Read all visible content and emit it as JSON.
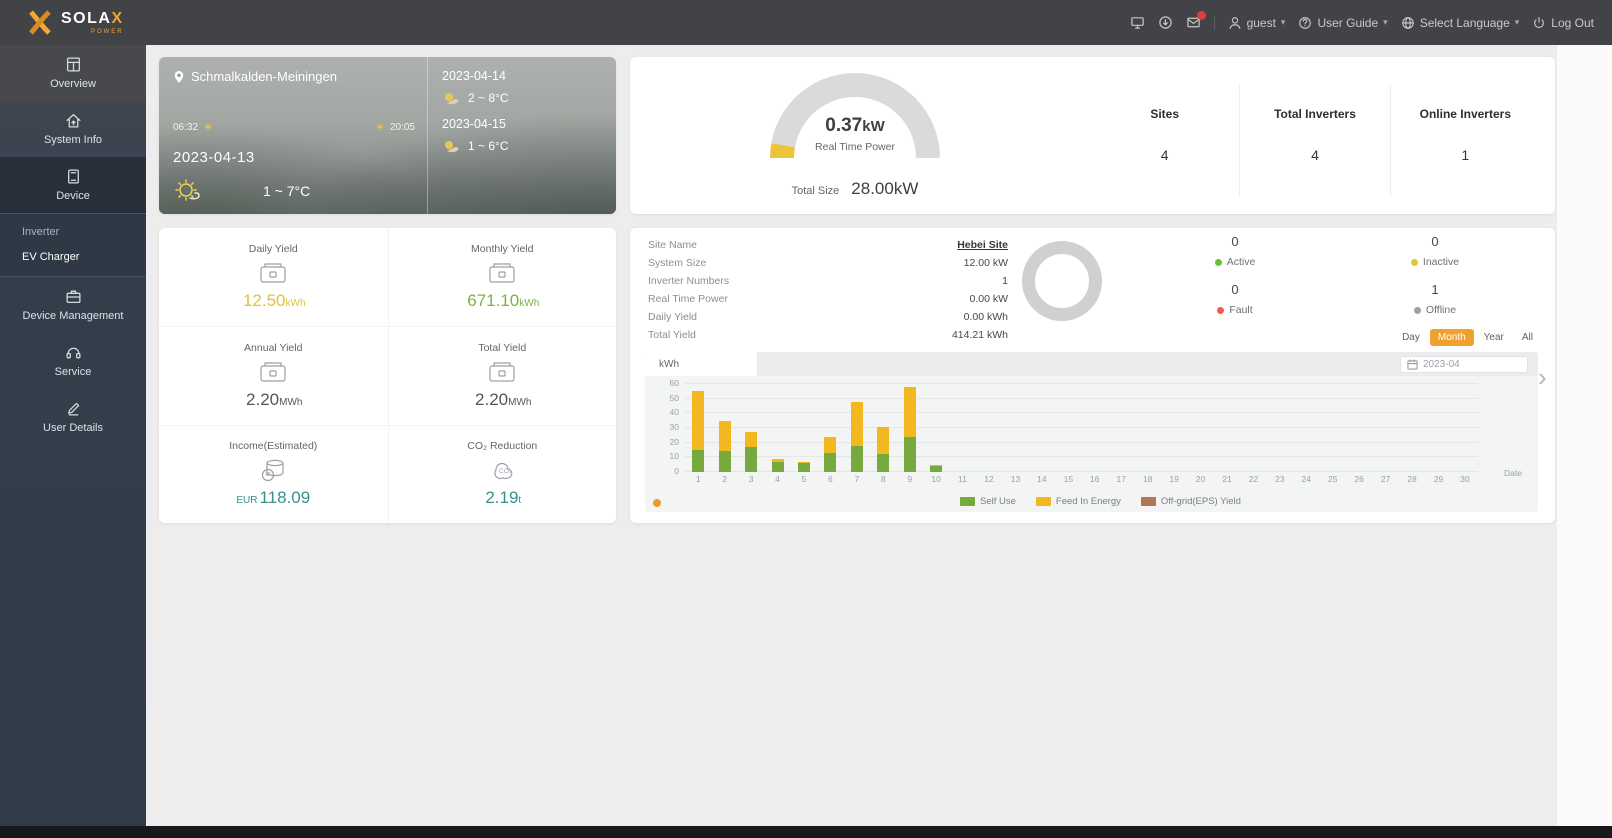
{
  "navbar": {
    "brand": "SOLA",
    "brand_x": "X",
    "brand_sub": "POWER",
    "username": "guest",
    "user_guide": "User Guide",
    "select_language": "Select Language",
    "logout": "Log Out"
  },
  "sidebar": {
    "items": [
      {
        "label": "Overview"
      },
      {
        "label": "System Info"
      },
      {
        "label": "Device"
      },
      {
        "label": "Device Management"
      },
      {
        "label": "Service"
      },
      {
        "label": "User Details"
      }
    ],
    "device_submenu": [
      {
        "label": "Inverter"
      },
      {
        "label": "EV Charger",
        "active": true
      }
    ]
  },
  "weather": {
    "location": "Schmalkalden-Meiningen",
    "sunrise": "06:32",
    "sunset": "20:05",
    "today_date": "2023-04-13",
    "today_temp": "1 ~ 7°C",
    "forecast": [
      {
        "date": "2023-04-14",
        "temp": "2 ~ 8°C"
      },
      {
        "date": "2023-04-15",
        "temp": "1 ~ 6°C"
      }
    ]
  },
  "gauge": {
    "power_value": "0.37",
    "power_unit": "kW",
    "power_label": "Real Time Power",
    "total_label": "Total Size",
    "total_value": "28.00kW",
    "stats": [
      {
        "label": "Sites",
        "value": "4"
      },
      {
        "label": "Total Inverters",
        "value": "4"
      },
      {
        "label": "Online Inverters",
        "value": "1"
      }
    ]
  },
  "yield_card": {
    "cells": [
      {
        "label": "Daily Yield",
        "prefix": "",
        "value": "12.50",
        "unit": "kWh",
        "color": "#dfc33c"
      },
      {
        "label": "Monthly Yield",
        "prefix": "",
        "value": "671.10",
        "unit": "kWh",
        "color": "#7cb342"
      },
      {
        "label": "Annual Yield",
        "prefix": "",
        "value": "2.20",
        "unit": "MWh",
        "color": "#53575c"
      },
      {
        "label": "Total Yield",
        "prefix": "",
        "value": "2.20",
        "unit": "MWh",
        "color": "#53575c"
      },
      {
        "label": "Income(Estimated)",
        "prefix": "EUR",
        "value": "118.09",
        "unit": "",
        "color": "#35918a"
      },
      {
        "label": "CO₂ Reduction",
        "prefix": "",
        "value": "2.19",
        "unit": "t",
        "color": "#35918a"
      }
    ]
  },
  "site_panel": {
    "fields": [
      {
        "label": "Site Name",
        "value": "Hebei Site"
      },
      {
        "label": "System Size",
        "value": "12.00 kW"
      },
      {
        "label": "Inverter Numbers",
        "value": "1"
      },
      {
        "label": "Real Time Power",
        "value": "0.00 kW"
      },
      {
        "label": "Daily Yield",
        "value": "0.00 kWh"
      },
      {
        "label": "Total Yield",
        "value": "414.21 kWh"
      }
    ],
    "statuses": [
      {
        "label": "Active",
        "value": "0",
        "color": "#67c23a"
      },
      {
        "label": "Inactive",
        "value": "0",
        "color": "#e6c23a"
      },
      {
        "label": "Fault",
        "value": "0",
        "color": "#f05b50"
      },
      {
        "label": "Offline",
        "value": "1",
        "color": "#9aa0a6"
      }
    ],
    "range_buttons": [
      {
        "label": "Day"
      },
      {
        "label": "Month",
        "active": true
      },
      {
        "label": "Year"
      },
      {
        "label": "All"
      }
    ],
    "date_value": "2023-04",
    "unit_tab": "kWh"
  },
  "chart_data": {
    "type": "bar",
    "stacked": true,
    "x": [
      "1",
      "2",
      "3",
      "4",
      "5",
      "6",
      "7",
      "8",
      "9",
      "10",
      "11",
      "12",
      "13",
      "14",
      "15",
      "16",
      "17",
      "18",
      "19",
      "20",
      "21",
      "22",
      "23",
      "24",
      "25",
      "26",
      "27",
      "28",
      "29",
      "30"
    ],
    "xlabel": "Date",
    "ylabel": "kWh",
    "ylim": [
      0,
      60
    ],
    "yticks": [
      0,
      10,
      20,
      30,
      40,
      50,
      60
    ],
    "grid": true,
    "legend_position": "bottom",
    "series": [
      {
        "name": "Self Use",
        "color": "#76a93e",
        "values": [
          15,
          14,
          17,
          7,
          6,
          13,
          18,
          12,
          24,
          4,
          0,
          0,
          0,
          0,
          0,
          0,
          0,
          0,
          0,
          0,
          0,
          0,
          0,
          0,
          0,
          0,
          0,
          0,
          0,
          0
        ]
      },
      {
        "name": "Feed In Energy",
        "color": "#f3b820",
        "values": [
          40,
          21,
          10,
          2,
          1,
          11,
          30,
          19,
          34,
          1,
          0,
          0,
          0,
          0,
          0,
          0,
          0,
          0,
          0,
          0,
          0,
          0,
          0,
          0,
          0,
          0,
          0,
          0,
          0,
          0
        ]
      },
      {
        "name": "Off-grid(EPS) Yield",
        "color": "#b2755a",
        "values": [
          0,
          0,
          0,
          0,
          0,
          0,
          0,
          0,
          0,
          0,
          0,
          0,
          0,
          0,
          0,
          0,
          0,
          0,
          0,
          0,
          0,
          0,
          0,
          0,
          0,
          0,
          0,
          0,
          0,
          0
        ]
      }
    ]
  }
}
